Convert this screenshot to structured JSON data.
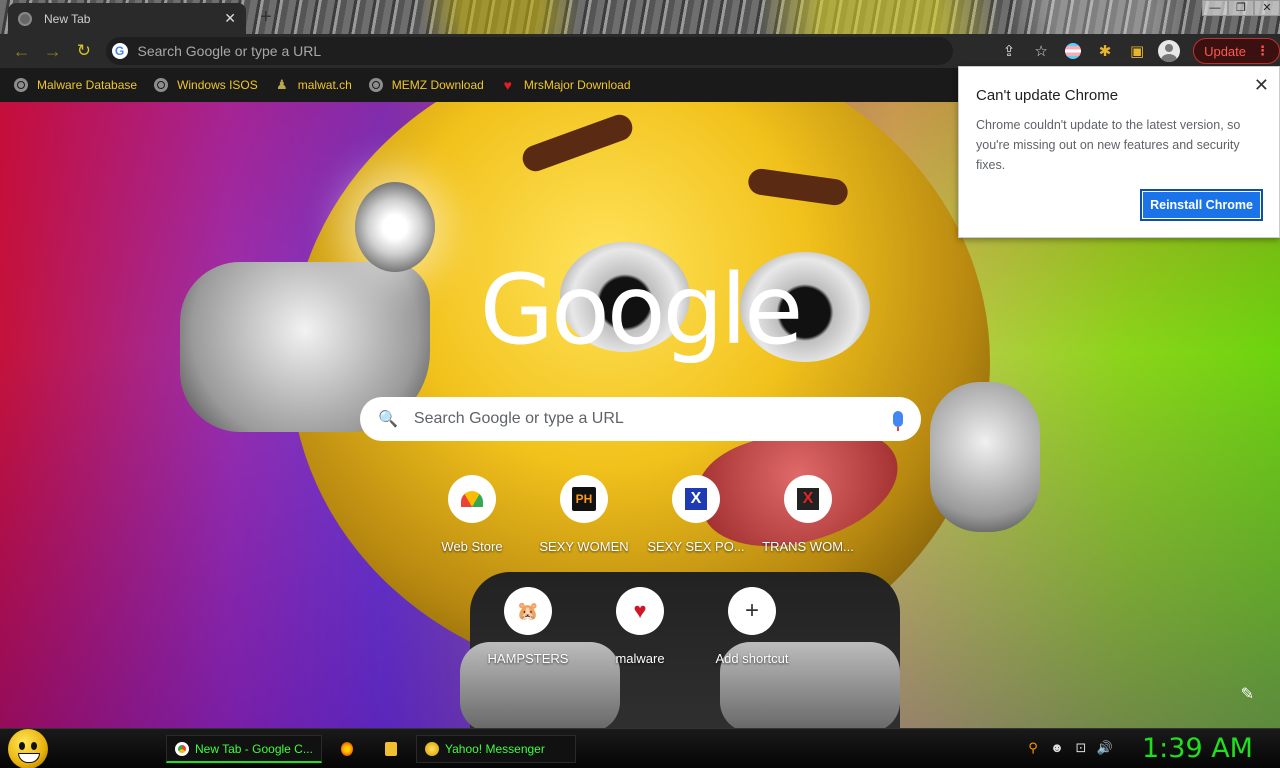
{
  "window": {
    "tab_title": "New Tab",
    "tab_close": "✕",
    "new_tab": "+",
    "controls": [
      "—",
      "❐",
      "✕"
    ]
  },
  "toolbar": {
    "back": "←",
    "forward": "→",
    "refresh": "↻",
    "omnibox_placeholder": "Search Google or type a URL",
    "share": "⇪",
    "star": "☆",
    "extensions": "✱",
    "side_panel": "▣",
    "update_label": "Update",
    "menu_dots": "⋮"
  },
  "bookmarks": [
    {
      "label": "Malware Database",
      "icon": "globe-icon"
    },
    {
      "label": "Windows ISOS",
      "icon": "globe-icon"
    },
    {
      "label": "malwat.ch",
      "icon": "person-icon"
    },
    {
      "label": "MEMZ Download",
      "icon": "globe-icon"
    },
    {
      "label": "MrsMajor Download",
      "icon": "heart-icon"
    }
  ],
  "ntp": {
    "logo": "Google",
    "search_placeholder": "Search Google or type a URL",
    "search_icon": "🔍",
    "shortcuts": [
      {
        "label": "Web Store",
        "icon": "webstore-icon"
      },
      {
        "label": "SEXY WOMEN",
        "icon": "ph-icon",
        "glyph": "PH"
      },
      {
        "label": "SEXY SEX PO...",
        "icon": "x-blue-icon",
        "glyph": "X"
      },
      {
        "label": "TRANS WOM...",
        "icon": "x-red-icon",
        "glyph": "X"
      },
      {
        "label": "HAMPSTERS",
        "icon": "hamster-icon",
        "glyph": "🐹"
      },
      {
        "label": "malware",
        "icon": "heart-icon",
        "glyph": "♥"
      },
      {
        "label": "Add shortcut",
        "icon": "plus-icon",
        "glyph": "+"
      }
    ],
    "edit_icon": "✎"
  },
  "popup": {
    "title": "Can't update Chrome",
    "body": "Chrome couldn't update to the latest version, so you're missing out on new features and security fixes.",
    "button": "Reinstall Chrome",
    "close": "✕"
  },
  "taskbar": {
    "items": [
      {
        "label": "New Tab - Google C...",
        "icon": "chrome-icon"
      },
      {
        "label": "",
        "icon": "firefox-icon"
      },
      {
        "label": "",
        "icon": "folder-icon"
      },
      {
        "label": "Yahoo! Messenger",
        "icon": "smiley-icon"
      }
    ],
    "tray": [
      "⚲",
      "☻",
      "⊡",
      "🔊"
    ],
    "clock": "1:39 AM"
  }
}
